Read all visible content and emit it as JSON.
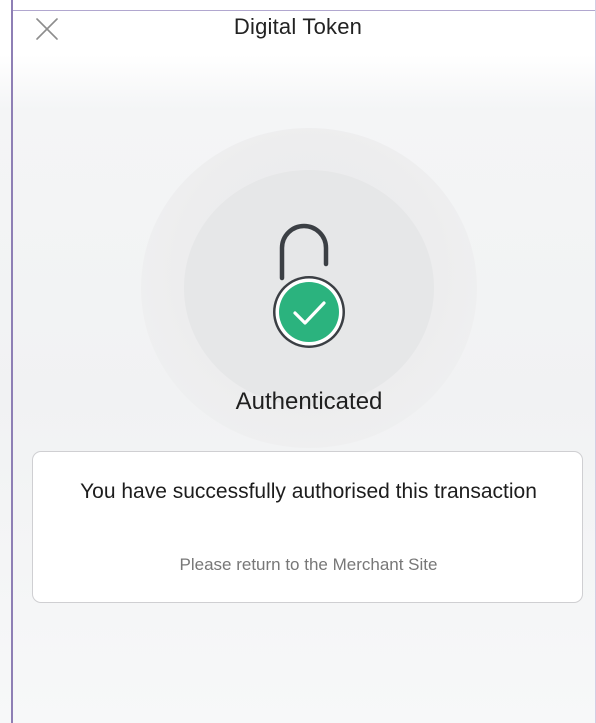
{
  "header": {
    "title": "Digital Token",
    "close_icon": "close-icon"
  },
  "status": {
    "icon": "unlocked-padlock-check-icon",
    "label": "Authenticated",
    "accent_color": "#2bb37e"
  },
  "message_card": {
    "title": "You have successfully authorised this transaction",
    "subtitle": "Please return to the Merchant Site"
  }
}
